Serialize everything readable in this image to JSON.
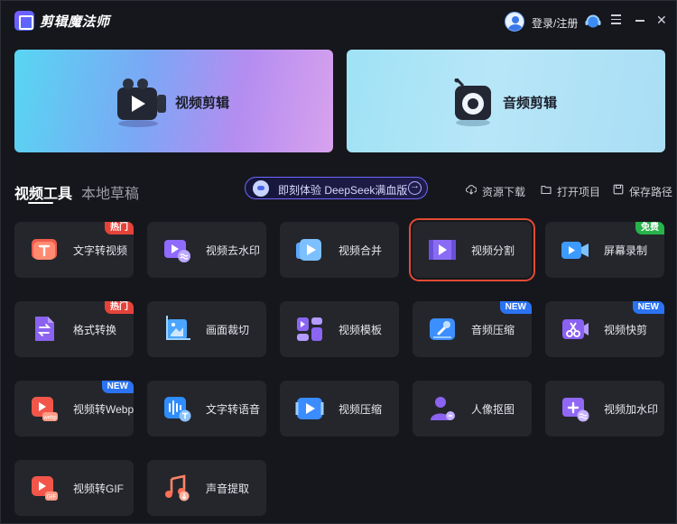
{
  "app": {
    "title": "剪辑魔法师",
    "login_label": "登录/注册"
  },
  "hero": {
    "video": {
      "label": "视频剪辑"
    },
    "audio": {
      "label": "音频剪辑"
    }
  },
  "tabs": [
    {
      "label": "视频工具",
      "active": true
    },
    {
      "label": "本地草稿",
      "active": false
    }
  ],
  "deepseek_banner": {
    "text": "即刻体验 DeepSeek满血版"
  },
  "actions": [
    {
      "label": "资源下载",
      "icon": "cloud-download-icon"
    },
    {
      "label": "打开项目",
      "icon": "folder-icon"
    },
    {
      "label": "保存路径",
      "icon": "save-icon"
    }
  ],
  "colors": {
    "accent_blue": "#2b73f2",
    "hot_red": "#e5433a",
    "free_green": "#27b24a",
    "selection": "#e34a34"
  },
  "tools": [
    {
      "label": "文字转视频",
      "badge": "热门",
      "icon": "text-to-video-icon"
    },
    {
      "label": "视频去水印",
      "badge": "",
      "icon": "remove-watermark-icon"
    },
    {
      "label": "视频合并",
      "badge": "",
      "icon": "video-merge-icon"
    },
    {
      "label": "视频分割",
      "badge": "",
      "icon": "video-split-icon",
      "selected": true
    },
    {
      "label": "屏幕录制",
      "badge": "免费",
      "icon": "screen-record-icon"
    },
    {
      "label": "格式转换",
      "badge": "热门",
      "icon": "format-convert-icon"
    },
    {
      "label": "画面裁切",
      "badge": "",
      "icon": "crop-icon"
    },
    {
      "label": "视频模板",
      "badge": "",
      "icon": "video-template-icon"
    },
    {
      "label": "音频压缩",
      "badge": "NEW",
      "icon": "audio-compress-icon"
    },
    {
      "label": "视频快剪",
      "badge": "NEW",
      "icon": "quick-cut-icon"
    },
    {
      "label": "视频转Webp",
      "badge": "NEW",
      "icon": "video-to-webp-icon"
    },
    {
      "label": "文字转语音",
      "badge": "",
      "icon": "text-to-speech-icon"
    },
    {
      "label": "视频压缩",
      "badge": "",
      "icon": "video-compress-icon"
    },
    {
      "label": "人像抠图",
      "badge": "",
      "icon": "portrait-cutout-icon"
    },
    {
      "label": "视频加水印",
      "badge": "",
      "icon": "add-watermark-icon"
    },
    {
      "label": "视频转GIF",
      "badge": "",
      "icon": "video-to-gif-icon"
    },
    {
      "label": "声音提取",
      "badge": "",
      "icon": "audio-extract-icon"
    }
  ]
}
